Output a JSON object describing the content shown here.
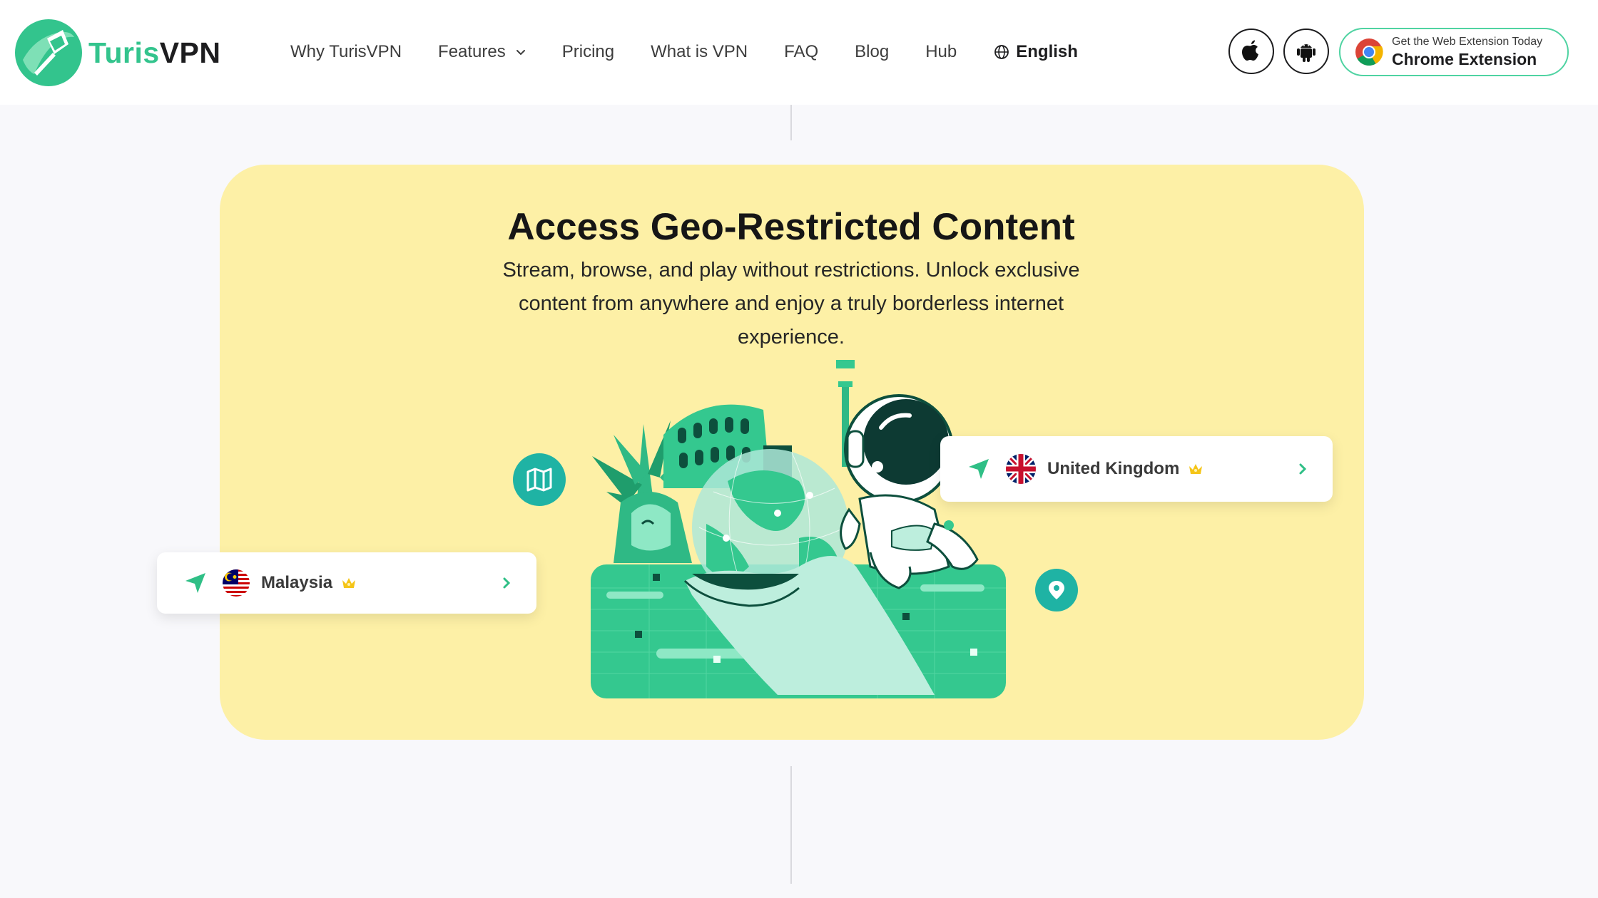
{
  "header": {
    "brand_part1": "Turis",
    "brand_part2": "VPN",
    "nav": [
      {
        "label": "Why TurisVPN"
      },
      {
        "label": "Features"
      },
      {
        "label": "Pricing"
      },
      {
        "label": "What is VPN"
      },
      {
        "label": "FAQ"
      },
      {
        "label": "Blog"
      },
      {
        "label": "Hub"
      }
    ],
    "language": "English",
    "extension": {
      "small_label": "Get the Web Extension Today",
      "big_label": "Chrome Extension"
    }
  },
  "hero": {
    "title": "Access Geo-Restricted Content",
    "subtitle": "Stream, browse, and play without restrictions. Unlock exclusive content from anywhere and enjoy a truly borderless internet experience."
  },
  "locations": [
    {
      "name": "Malaysia"
    },
    {
      "name": "United Kingdom"
    }
  ],
  "colors": {
    "brand_green": "#33c48d",
    "card_bg": "#fdf0a6",
    "icon_teal": "#1fb3a4"
  }
}
